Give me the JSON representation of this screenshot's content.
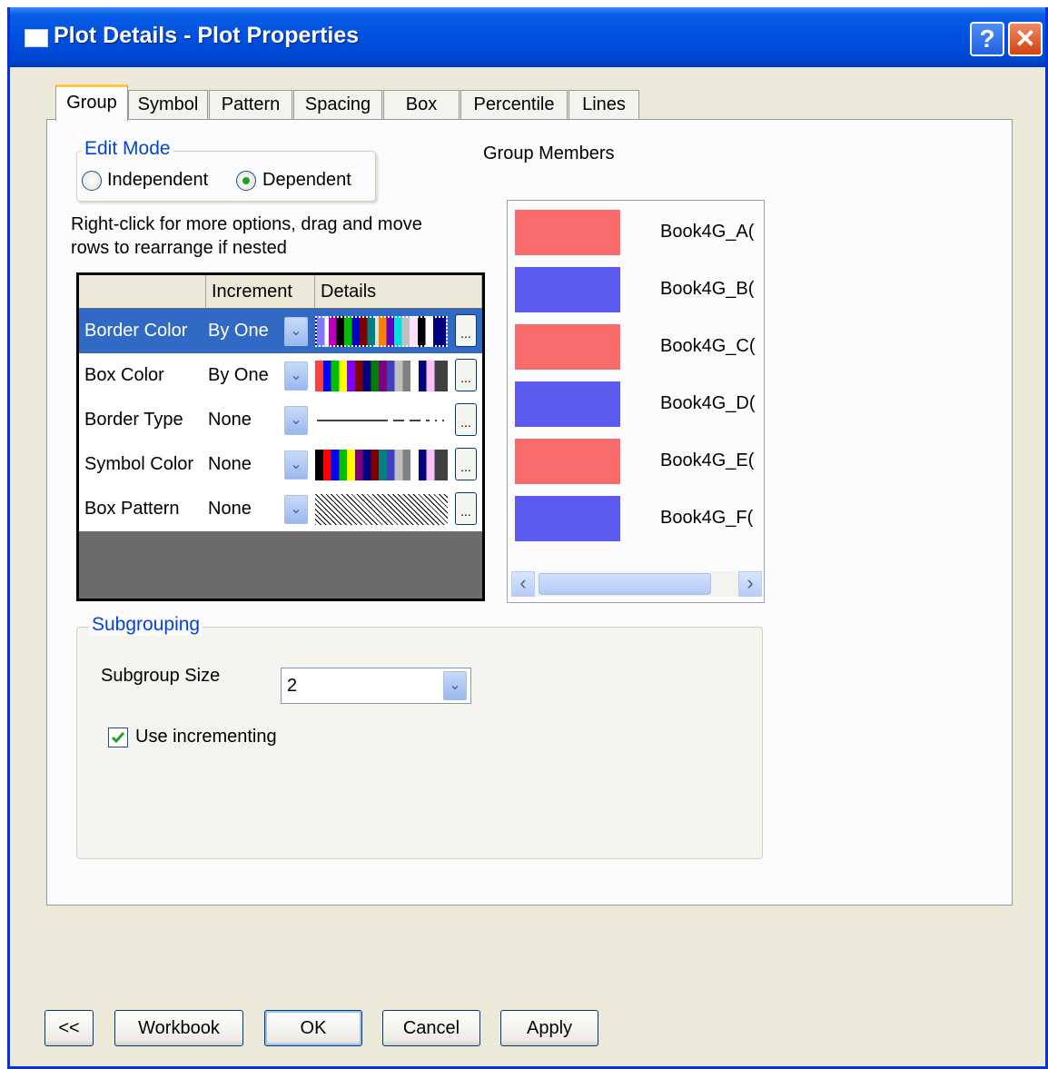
{
  "window": {
    "title": "Plot Details - Plot Properties",
    "help_glyph": "?",
    "close_glyph": "✕"
  },
  "tabs": [
    "Group",
    "Symbol",
    "Pattern",
    "Spacing",
    "Box",
    "Percentile",
    "Lines"
  ],
  "active_tab": "Group",
  "edit_mode": {
    "label": "Edit Mode",
    "options": [
      "Independent",
      "Dependent"
    ],
    "selected": "Dependent"
  },
  "hint": {
    "line1": "Right-click for more options, drag and move",
    "line2": "rows to  rearrange if nested"
  },
  "grid": {
    "headers": [
      "",
      "Increment",
      "Details"
    ],
    "rows": [
      {
        "name": "Border Color",
        "increment": "By One",
        "details": "color-list",
        "selected": true
      },
      {
        "name": "Box Color",
        "increment": "By One",
        "details": "color-list",
        "selected": false
      },
      {
        "name": "Border Type",
        "increment": "None",
        "details": "line-style-list",
        "selected": false
      },
      {
        "name": "Symbol Color",
        "increment": "None",
        "details": "color-list",
        "selected": false
      },
      {
        "name": "Box Pattern",
        "increment": "None",
        "details": "pattern-list",
        "selected": false
      }
    ],
    "dropdown_glyph": "⌄",
    "ellipsis": "..."
  },
  "group_members": {
    "label": "Group Members",
    "items": [
      {
        "name": "Book4G_A(",
        "color": "#f76b6b"
      },
      {
        "name": "Book4G_B(",
        "color": "#5b5bf0"
      },
      {
        "name": "Book4G_C(",
        "color": "#f76b6b"
      },
      {
        "name": "Book4G_D(",
        "color": "#5b5bf0"
      },
      {
        "name": "Book4G_E(",
        "color": "#f76b6b"
      },
      {
        "name": "Book4G_F(",
        "color": "#5b5bf0"
      }
    ],
    "scroll_left": "‹",
    "scroll_right": "›"
  },
  "subgrouping": {
    "label": "Subgrouping",
    "size_label": "Subgroup Size",
    "size_value": "2",
    "use_incrementing_label": "Use incrementing",
    "use_incrementing_checked": true
  },
  "buttons": {
    "collapse": "<<",
    "workbook": "Workbook",
    "ok": "OK",
    "cancel": "Cancel",
    "apply": "Apply"
  },
  "colors": {
    "title_blue": "#0050e0",
    "selection": "#316ac5",
    "red_member": "#f76b6b",
    "blue_member": "#5b5bf0"
  }
}
